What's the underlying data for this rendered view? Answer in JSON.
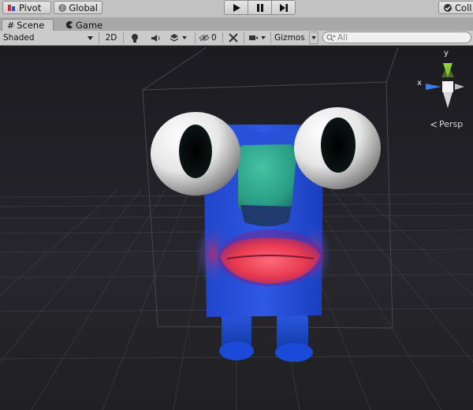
{
  "toolbar": {
    "pivot_label": "Pivot",
    "global_label": "Global",
    "collab_label": "Coll",
    "play_icon": "play-icon",
    "pause_icon": "pause-icon",
    "step_icon": "step-icon"
  },
  "tabs": [
    {
      "label": "Scene",
      "icon": "grid-icon",
      "active": true
    },
    {
      "label": "Game",
      "icon": "pacman-icon",
      "active": false
    }
  ],
  "scene_toolbar": {
    "draw_mode": "Shaded",
    "mode_2d": "2D",
    "hidden_count": "0",
    "gizmos_label": "Gizmos",
    "search_placeholder": "All"
  },
  "gizmo": {
    "y_label": "y",
    "x_label": "x",
    "projection_label": "Persp",
    "x_color": "#e34a3a",
    "y_color": "#8fd23a",
    "z_color": "#3a7de3"
  },
  "colors": {
    "toolbar_bg": "#c2c2c2",
    "viewport_bg": "#1e1e22",
    "character_body": "#2a4fd8",
    "character_nose": "#2fa88c",
    "character_mouth": "#e8394f"
  }
}
